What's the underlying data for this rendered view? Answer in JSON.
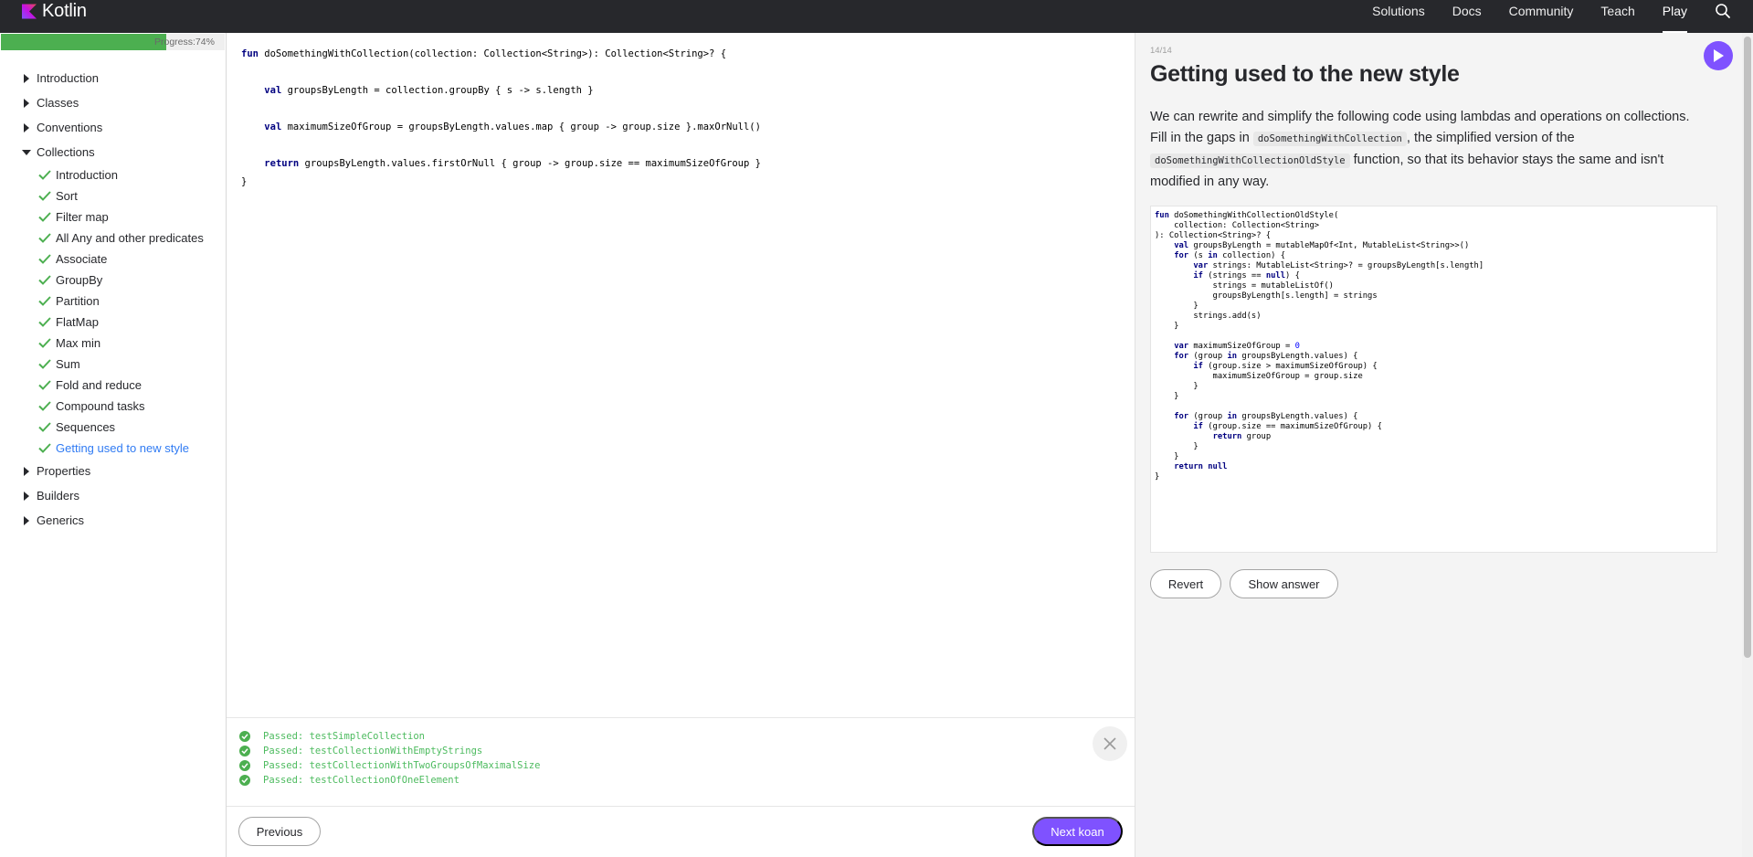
{
  "header": {
    "logo_text": "Kotlin",
    "nav": [
      "Solutions",
      "Docs",
      "Community",
      "Teach",
      "Play"
    ],
    "active_nav": "Play",
    "brand_color": "#7f52ff"
  },
  "sidebar": {
    "progress_label": "Progress:74%",
    "progress_fraction": 0.74,
    "sections_before": [
      "Introduction",
      "Classes",
      "Conventions"
    ],
    "open_section": "Collections",
    "tasks": [
      "Introduction",
      "Sort",
      "Filter map",
      "All Any and other predicates",
      "Associate",
      "GroupBy",
      "Partition",
      "FlatMap",
      "Max min",
      "Sum",
      "Fold and reduce",
      "Compound tasks",
      "Sequences",
      "Getting used to new style"
    ],
    "current_task": "Getting used to new style",
    "sections_after": [
      "Properties",
      "Builders",
      "Generics"
    ]
  },
  "editor": {
    "lines": [
      "fun doSomethingWithCollection(collection: Collection<String>): Collection<String>? {",
      "    val groupsByLength = collection.groupBy { s -> s.length }",
      "    val maximumSizeOfGroup = groupsByLength.values.map { group -> group.size }.maxOrNull()",
      "    return groupsByLength.values.firstOrNull { group -> group.size == maximumSizeOfGroup }",
      "}"
    ]
  },
  "results": {
    "tests": [
      "Passed: testSimpleCollection",
      "Passed: testCollectionWithEmptyStrings",
      "Passed: testCollectionWithTwoGroupsOfMaximalSize",
      "Passed: testCollectionOfOneElement"
    ]
  },
  "footer": {
    "previous_label": "Previous",
    "next_label": "Next koan"
  },
  "task_panel": {
    "counter": "14/14",
    "title": "Getting used to the new style",
    "desc_part1": "We can rewrite and simplify the following code using lambdas and operations on collections. Fill in the gaps in ",
    "desc_code1": "doSomethingWithCollection",
    "desc_part2": ", the simplified version of the ",
    "desc_code2": "doSomethingWithCollectionOldStyle",
    "desc_part3": " function, so that its behavior stays the same and isn't modified in any way.",
    "old_code": [
      "fun doSomethingWithCollectionOldStyle(",
      "    collection: Collection<String>",
      "): Collection<String>? {",
      "    val groupsByLength = mutableMapOf<Int, MutableList<String>>()",
      "    for (s in collection) {",
      "        var strings: MutableList<String>? = groupsByLength[s.length]",
      "        if (strings == null) {",
      "            strings = mutableListOf()",
      "            groupsByLength[s.length] = strings",
      "        }",
      "        strings.add(s)",
      "    }",
      "",
      "    var maximumSizeOfGroup = 0",
      "    for (group in groupsByLength.values) {",
      "        if (group.size > maximumSizeOfGroup) {",
      "            maximumSizeOfGroup = group.size",
      "        }",
      "    }",
      "",
      "    for (group in groupsByLength.values) {",
      "        if (group.size == maximumSizeOfGroup) {",
      "            return group",
      "        }",
      "    }",
      "    return null",
      "}"
    ],
    "revert_label": "Revert",
    "show_answer_label": "Show answer"
  }
}
